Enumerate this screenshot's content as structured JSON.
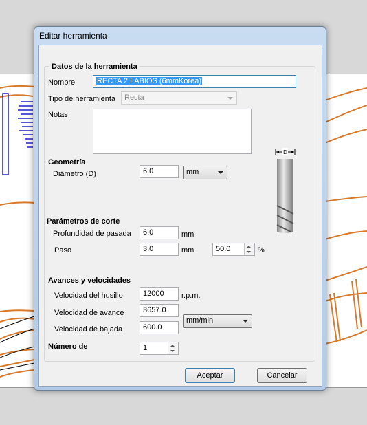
{
  "window": {
    "title": "Editar herramienta"
  },
  "tool_data": {
    "heading": "Datos de la herramienta",
    "name_label": "Nombre",
    "name_value": "RECTA 2 LABIOS (6mmKorea)",
    "type_label": "Tipo de herramienta",
    "type_value": "Recta",
    "notes_label": "Notas",
    "notes_value": ""
  },
  "geometry": {
    "heading": "Geometría",
    "diameter_label": "Diámetro (D)",
    "diameter_value": "6.0",
    "unit_value": "mm",
    "diagram_label": "D"
  },
  "cutting": {
    "heading": "Parámetros de corte",
    "pass_depth_label": "Profundidad de pasada",
    "pass_depth_value": "6.0",
    "pass_depth_unit": "mm",
    "stepover_label": "Paso",
    "stepover_value": "3.0",
    "stepover_unit": "mm",
    "stepover_percent_value": "50.0",
    "percent_sign": "%"
  },
  "feeds": {
    "heading": "Avances y velocidades",
    "spindle_label": "Velocidad del husillo",
    "spindle_value": "12000",
    "spindle_unit": "r.p.m.",
    "feed_label": "Velocidad de avance",
    "feed_value": "3657.0",
    "plunge_label": "Velocidad de bajada",
    "plunge_value": "600.0",
    "rate_unit_value": "mm/min"
  },
  "teeth": {
    "heading": "Número de",
    "value": "1"
  },
  "buttons": {
    "ok": "Aceptar",
    "cancel": "Cancelar"
  },
  "colors": {
    "toolpath": "#d97a2b",
    "vector": "#2020c8",
    "selection": "#3399ff",
    "default_button": "#3c7fb1"
  }
}
